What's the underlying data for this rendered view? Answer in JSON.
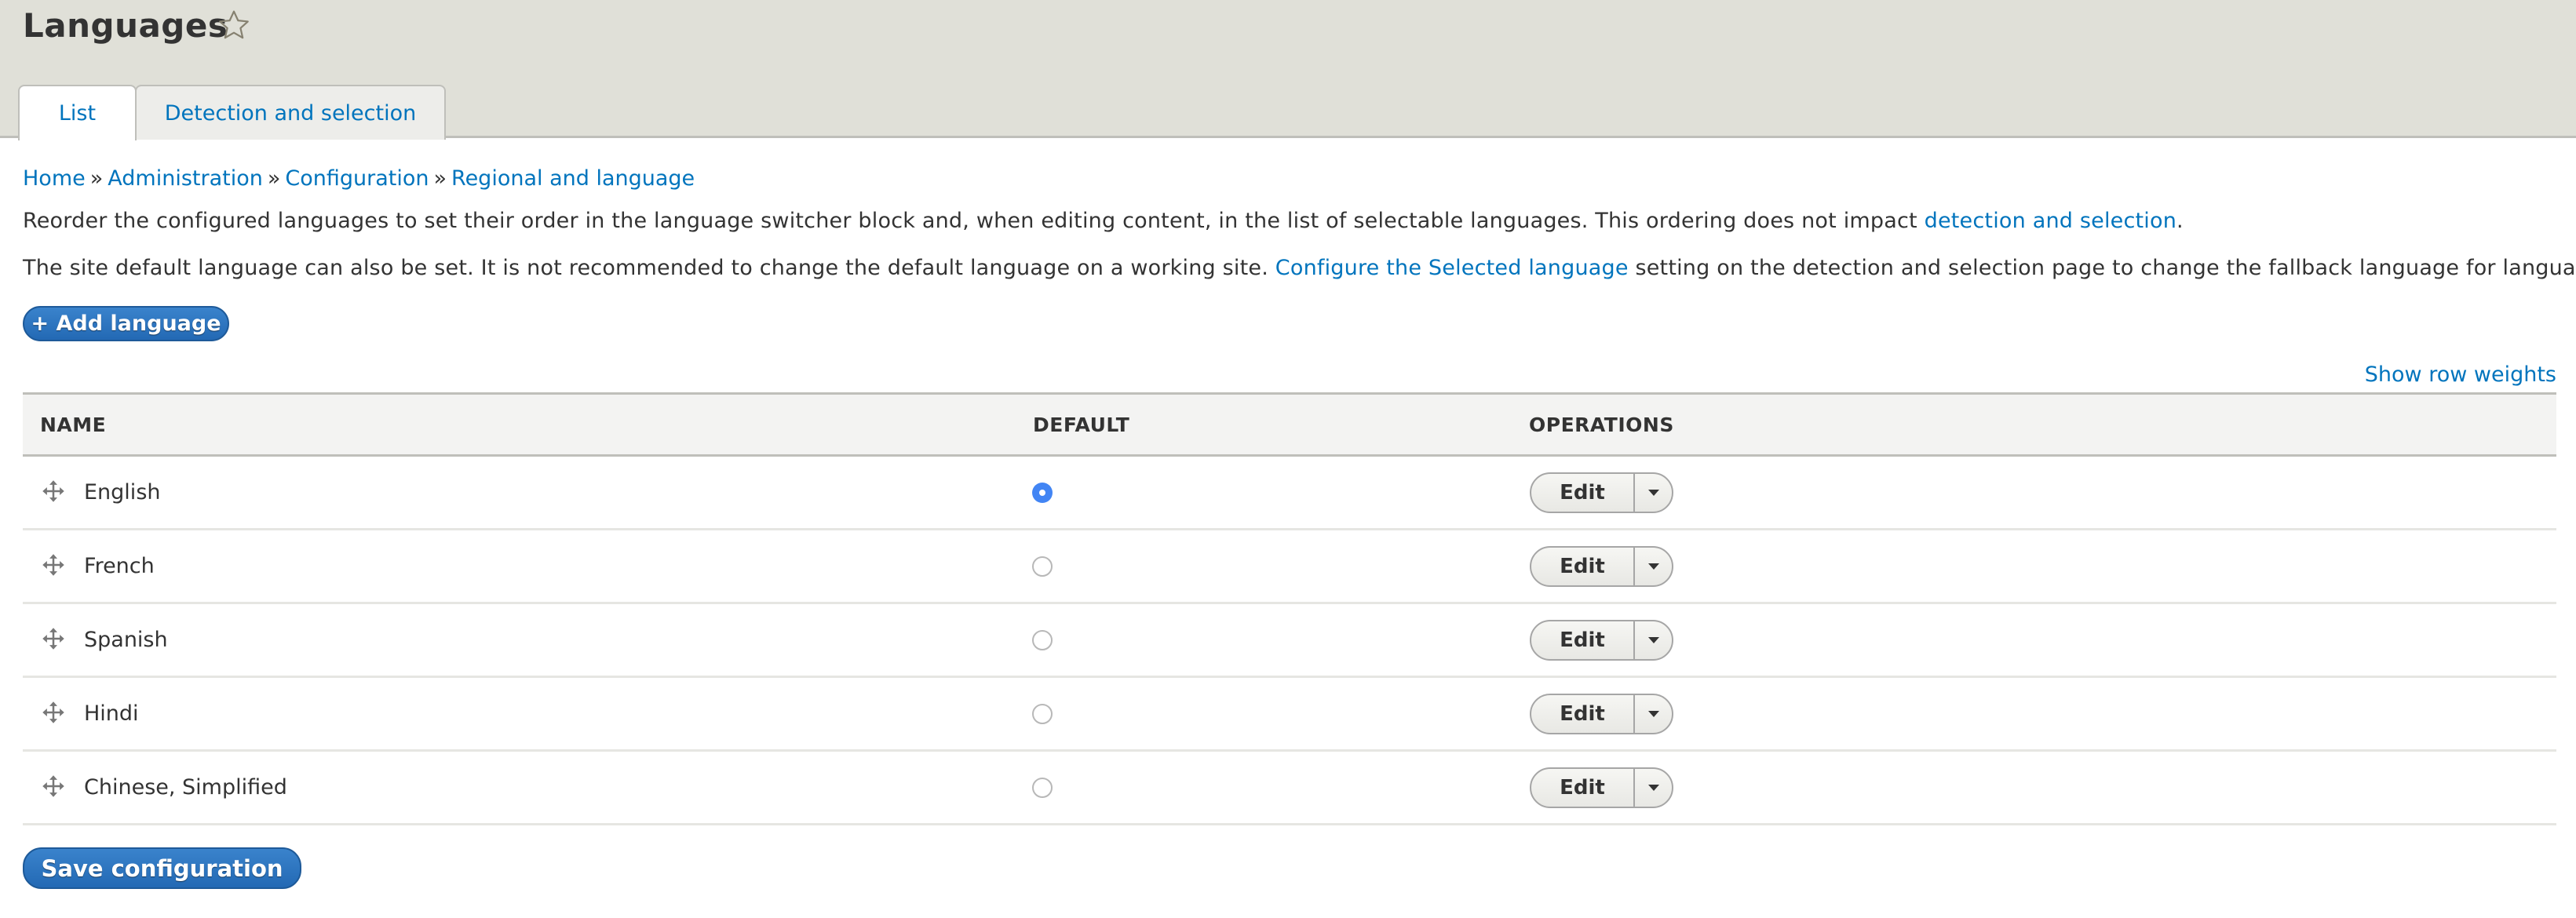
{
  "header": {
    "title": "Languages",
    "tabs": [
      {
        "label": "List",
        "active": true
      },
      {
        "label": "Detection and selection",
        "active": false
      }
    ]
  },
  "breadcrumb": [
    {
      "label": "Home"
    },
    {
      "label": "Administration"
    },
    {
      "label": "Configuration"
    },
    {
      "label": "Regional and language"
    }
  ],
  "breadcrumb_separator": "»",
  "intro": {
    "p1_text": "Reorder the configured languages to set their order in the language switcher block and, when editing content, in the list of selectable languages. This ordering does not impact ",
    "p1_link": "detection and selection",
    "p1_end": ".",
    "p2_text": "The site default language can also be set. It is not recommended to change the default language on a working site. ",
    "p2_link": "Configure the Selected language",
    "p2_end": " setting on the detection and selection page to change the fallback language for language selection."
  },
  "actions": {
    "add_language": "+ Add language",
    "show_row_weights": "Show row weights",
    "save": "Save configuration"
  },
  "table": {
    "columns": [
      "NAME",
      "DEFAULT",
      "OPERATIONS"
    ],
    "rows": [
      {
        "name": "English",
        "default": true,
        "operation": "Edit"
      },
      {
        "name": "French",
        "default": false,
        "operation": "Edit"
      },
      {
        "name": "Spanish",
        "default": false,
        "operation": "Edit"
      },
      {
        "name": "Hindi",
        "default": false,
        "operation": "Edit"
      },
      {
        "name": "Chinese, Simplified",
        "default": false,
        "operation": "Edit"
      }
    ]
  },
  "colors": {
    "link": "#0074bd",
    "primary_button": "#2f78c2",
    "header_bg": "#e0e0d8",
    "radio_checked": "#4285f4"
  }
}
